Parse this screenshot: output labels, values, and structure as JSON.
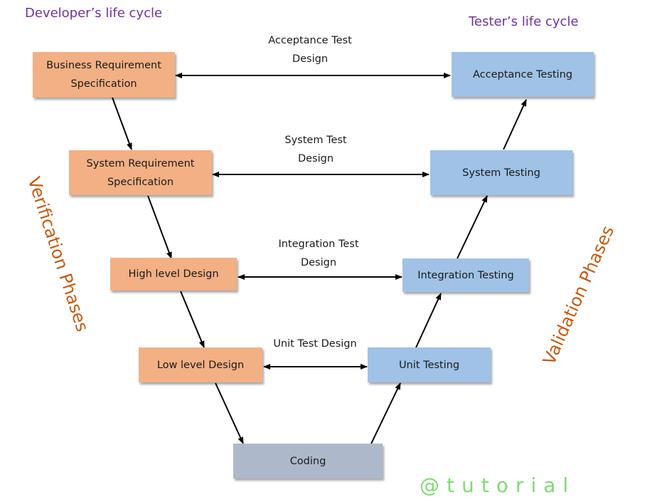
{
  "titles": {
    "developer": "Developer’s life cycle",
    "tester": "Tester’s life cycle"
  },
  "phases": {
    "verification": "Verification Phases",
    "validation": "Validation Phases"
  },
  "developer_boxes": [
    {
      "line1": "Business Requirement",
      "line2": "Specification"
    },
    {
      "line1": "System Requirement",
      "line2": "Specification"
    },
    {
      "line1": "High level Design",
      "line2": ""
    },
    {
      "line1": "Low level Design",
      "line2": ""
    }
  ],
  "tester_boxes": [
    {
      "label": "Acceptance Testing"
    },
    {
      "label": "System Testing"
    },
    {
      "label": "Integration Testing"
    },
    {
      "label": "Unit Testing"
    }
  ],
  "coding": {
    "label": "Coding"
  },
  "connector_labels": [
    {
      "line1": "Acceptance Test",
      "line2": "Design"
    },
    {
      "line1": "System Test",
      "line2": "Design"
    },
    {
      "line1": "Integration Test",
      "line2": "Design"
    },
    {
      "line1": "Unit Test Design",
      "line2": ""
    }
  ],
  "colors": {
    "developer_box": "#f2b084",
    "tester_box": "#9fc2e6",
    "coding_box": "#adb9cb",
    "title_text": "#7030a0",
    "phase_text": "#c55a11"
  },
  "watermark": {
    "text": "@tutorial"
  }
}
